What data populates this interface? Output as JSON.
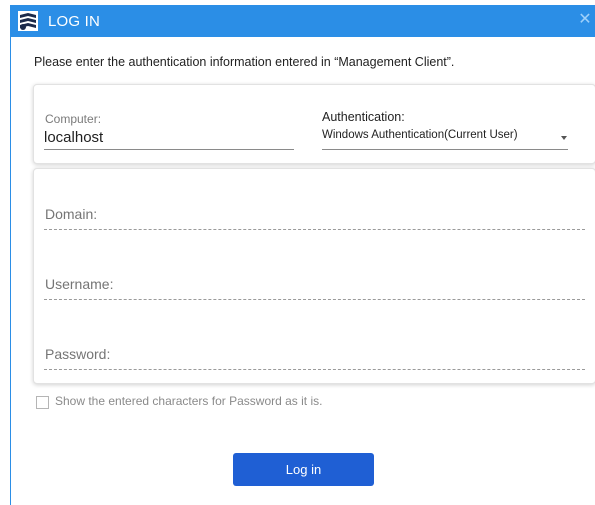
{
  "window": {
    "title": "LOG IN",
    "close_glyph": "✕",
    "app_icon": "login-app-icon",
    "accent_color": "#2b8ee6"
  },
  "instruction": "Please enter the authentication information entered in “Management Client”.",
  "connection": {
    "computer_label": "Computer:",
    "computer_value": "localhost",
    "auth_label": "Authentication:",
    "auth_value": "Windows Authentication(Current User)"
  },
  "credentials": {
    "domain_placeholder": "Domain:",
    "username_placeholder": "Username:",
    "password_placeholder": "Password:"
  },
  "show_password": {
    "label": "Show the entered characters for Password as it is.",
    "checked": false
  },
  "login_button": {
    "label": "Log in",
    "color": "#1f5fd4"
  }
}
